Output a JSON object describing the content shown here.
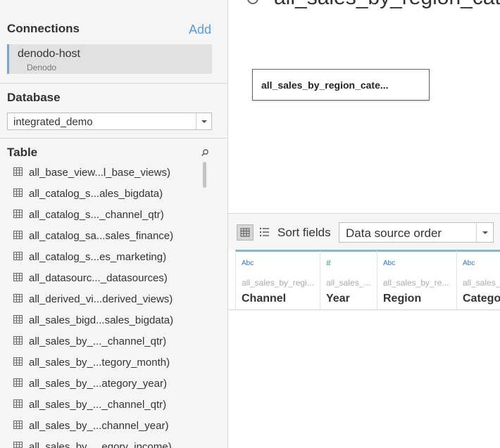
{
  "connections": {
    "heading": "Connections",
    "add_label": "Add",
    "items": [
      {
        "name": "denodo-host",
        "type": "Denodo"
      }
    ]
  },
  "database": {
    "heading": "Database",
    "selected": "integrated_demo"
  },
  "tables": {
    "heading": "Table",
    "items": [
      "all_base_view...l_base_views)",
      "all_catalog_s...ales_bigdata)",
      "all_catalog_s..._channel_qtr)",
      "all_catalog_sa...sales_finance)",
      "all_catalog_s...es_marketing)",
      "all_datasourc..._datasources)",
      "all_derived_vi...derived_views)",
      "all_sales_bigd...sales_bigdata)",
      "all_sales_by_..._channel_qtr)",
      "all_sales_by_...tegory_month)",
      "all_sales_by_...ategory_year)",
      "all_sales_by_..._channel_qtr)",
      "all_sales_by_...channel_year)",
      "all_sales_by_...egory_income)"
    ]
  },
  "canvas": {
    "title": "all_sales_by_region_category",
    "table_card": "all_sales_by_region_cate..."
  },
  "grid_toolbar": {
    "sort_label": "Sort fields",
    "sort_value": "Data source order"
  },
  "columns": [
    {
      "type": "Abc",
      "source": "all_sales_by_regi...",
      "name": "Channel"
    },
    {
      "type": "#",
      "source": "all_sales_...",
      "name": "Year"
    },
    {
      "type": "Abc",
      "source": "all_sales_by_re...",
      "name": "Region"
    },
    {
      "type": "Abc",
      "source": "all_sales_",
      "name": "Categor"
    }
  ],
  "colors": {
    "accent": "#5b9bd5",
    "panel_bg": "#f5f5f5",
    "column_top": "#7fb6d9"
  }
}
